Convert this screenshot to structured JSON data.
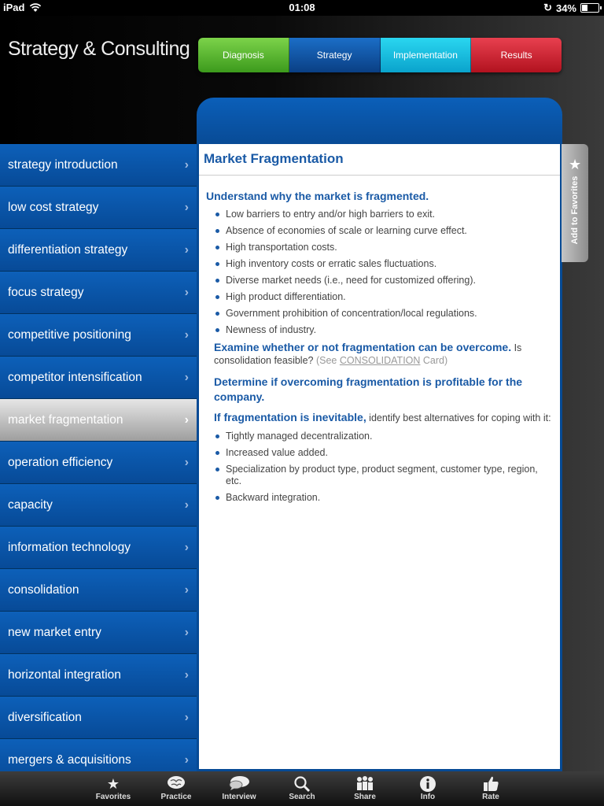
{
  "status": {
    "carrier": "iPad",
    "time": "01:08",
    "battery": "34%",
    "battery_level": 0.34
  },
  "app": {
    "title": "Strategy & Consulting"
  },
  "phase_tabs": [
    "Diagnosis",
    "Strategy",
    "Implementation",
    "Results"
  ],
  "favorites_tab": {
    "label": "Add to Favorites",
    "icon": "star-icon"
  },
  "sidebar": {
    "items": [
      {
        "label": "strategy introduction",
        "selected": false
      },
      {
        "label": "low cost strategy",
        "selected": false
      },
      {
        "label": "differentiation strategy",
        "selected": false
      },
      {
        "label": "focus strategy",
        "selected": false
      },
      {
        "label": "competitive positioning",
        "selected": false
      },
      {
        "label": "competitor intensification",
        "selected": false
      },
      {
        "label": "market fragmentation",
        "selected": true
      },
      {
        "label": "operation efficiency",
        "selected": false
      },
      {
        "label": "capacity",
        "selected": false
      },
      {
        "label": "information technology",
        "selected": false
      },
      {
        "label": "consolidation",
        "selected": false
      },
      {
        "label": "new market entry",
        "selected": false
      },
      {
        "label": "horizontal integration",
        "selected": false
      },
      {
        "label": "diversification",
        "selected": false
      },
      {
        "label": "mergers & acquisitions",
        "selected": false
      }
    ]
  },
  "content": {
    "title": "Market Fragmentation",
    "section1": {
      "heading": "Understand why the market is fragmented.",
      "bullets": [
        "Low barriers to entry and/or high barriers to exit.",
        "Absence of economies of scale or learning curve effect.",
        "High transportation costs.",
        "High inventory costs or erratic sales fluctuations.",
        "Diverse market needs (i.e., need for customized offering).",
        "High product differentiation.",
        "Government prohibition of concentration/local regulations.",
        "Newness of industry."
      ]
    },
    "section2": {
      "heading": "Examine whether or not fragmentation can be overcome.",
      "text": "Is consolidation feasible?",
      "see": "(See ",
      "link": "CONSOLIDATION",
      "card": " Card)"
    },
    "section3": {
      "heading": "Determine if overcoming fragmentation is profitable for the company."
    },
    "section4": {
      "heading": "If fragmentation is inevitable,",
      "text": " identify best alternatives for coping with it:",
      "bullets": [
        "Tightly managed decentralization.",
        "Increased value added.",
        "Specialization by product type, product segment, customer type, region, etc.",
        "Backward integration."
      ]
    }
  },
  "tabbar": [
    {
      "label": "Favorites",
      "icon": "star-icon"
    },
    {
      "label": "Practice",
      "icon": "brain-icon"
    },
    {
      "label": "Interview",
      "icon": "speech-bubbles-icon"
    },
    {
      "label": "Search",
      "icon": "search-icon"
    },
    {
      "label": "Share",
      "icon": "people-icon"
    },
    {
      "label": "Info",
      "icon": "info-icon"
    },
    {
      "label": "Rate",
      "icon": "thumbs-up-icon"
    }
  ]
}
